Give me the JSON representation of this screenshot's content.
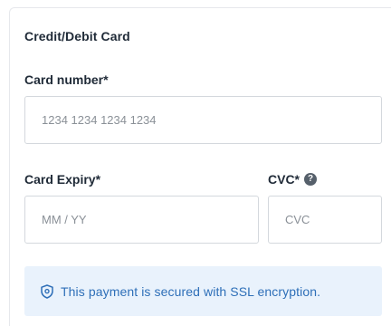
{
  "section": {
    "title": "Credit/Debit Card"
  },
  "card_number": {
    "label": "Card number*",
    "placeholder": "1234 1234 1234 1234"
  },
  "card_expiry": {
    "label": "Card Expiry*",
    "placeholder": "MM / YY"
  },
  "cvc": {
    "label": "CVC*",
    "help_icon": "question-circle-icon",
    "help_glyph": "?",
    "placeholder": "CVC"
  },
  "security_notice": {
    "icon": "shield-icon",
    "text": "This payment is secured with SSL encryption."
  },
  "colors": {
    "notice_background": "#e9f2fc",
    "notice_text": "#2e6fb8",
    "label_text": "#1f2a37",
    "input_border": "#d4d8dd",
    "placeholder_text": "#8a9097"
  }
}
